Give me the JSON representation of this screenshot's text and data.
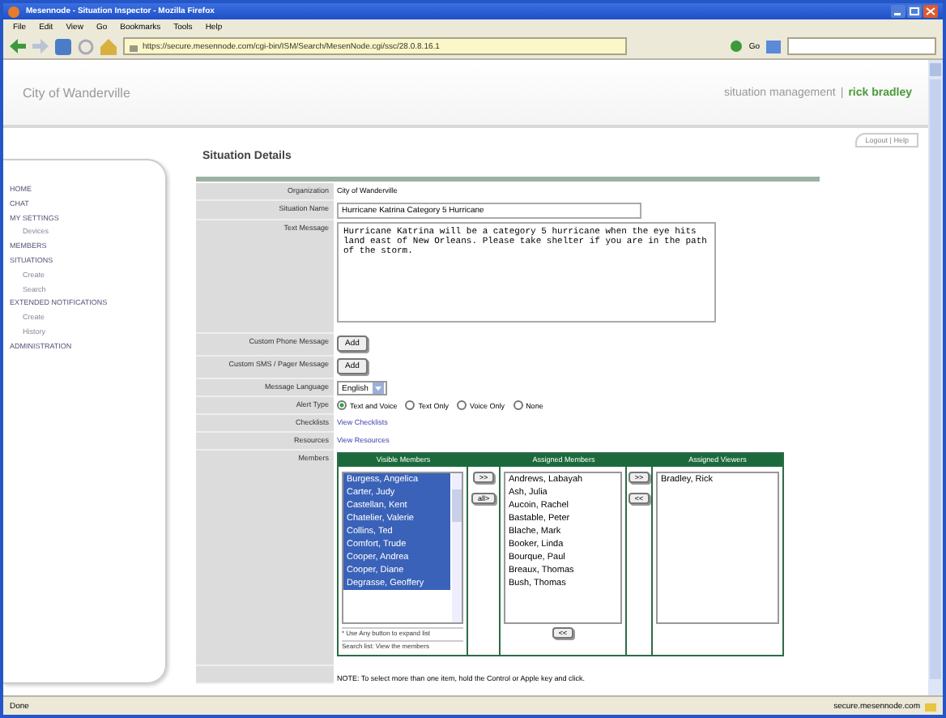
{
  "window": {
    "title": "Mesennode - Situation Inspector - Mozilla Firefox"
  },
  "menu": [
    "File",
    "Edit",
    "View",
    "Go",
    "Bookmarks",
    "Tools",
    "Help"
  ],
  "address": {
    "url": "https://secure.mesennode.com/cgi-bin/ISM/Search/MesenNode.cgi/ssc/28.0.8.16.1",
    "go": "Go"
  },
  "header": {
    "org": "City of Wanderville",
    "section": "situation management",
    "separator": "|",
    "user": "rick bradley",
    "links": "Logout | Help"
  },
  "sidebar": {
    "items": [
      {
        "label": "HOME"
      },
      {
        "label": "CHAT"
      },
      {
        "label": "MY SETTINGS",
        "children": [
          {
            "label": "Devices"
          }
        ]
      },
      {
        "label": "MEMBERS"
      },
      {
        "label": "SITUATIONS",
        "children": [
          {
            "label": "Create"
          },
          {
            "label": "Search"
          }
        ]
      },
      {
        "label": "EXTENDED NOTIFICATIONS",
        "children": [
          {
            "label": "Create"
          },
          {
            "label": "History"
          }
        ]
      },
      {
        "label": "ADMINISTRATION"
      }
    ]
  },
  "heading": "Situation Details",
  "form": {
    "organization": {
      "label": "Organization",
      "value": "City of Wanderville"
    },
    "name": {
      "label": "Situation Name",
      "value": "Hurricane Katrina Category 5 Hurricane"
    },
    "text": {
      "label": "Text Message",
      "value": "Hurricane Katrina will be a category 5 hurricane when the eye hits land east of New Orleans.  Please take shelter if you are in the path of the storm."
    },
    "phone": {
      "label": "Custom Phone Message",
      "button": "Add"
    },
    "sms": {
      "label": "Custom SMS / Pager Message",
      "button": "Add"
    },
    "language": {
      "label": "Message Language",
      "value": "English"
    },
    "alert": {
      "label": "Alert Type",
      "options": [
        {
          "label": "Text and Voice",
          "selected": true
        },
        {
          "label": "Text Only",
          "selected": false
        },
        {
          "label": "Voice Only",
          "selected": false
        },
        {
          "label": "None",
          "selected": false
        }
      ]
    },
    "checklists": {
      "label": "Checklists",
      "link": "View Checklists"
    },
    "resources": {
      "label": "Resources",
      "link": "View Resources"
    },
    "members": {
      "label": "Members",
      "visible": {
        "title": "Visible Members",
        "items": [
          {
            "label": "Burgess, Angelica",
            "selected": true
          },
          {
            "label": "Carter, Judy",
            "selected": true
          },
          {
            "label": "Castellan, Kent",
            "selected": true
          },
          {
            "label": "Chatelier, Valerie",
            "selected": true
          },
          {
            "label": "Collins, Ted",
            "selected": true
          },
          {
            "label": "Comfort, Trude",
            "selected": true
          },
          {
            "label": "Cooper, Andrea",
            "selected": true
          },
          {
            "label": "Cooper, Diane",
            "selected": true
          },
          {
            "label": "Degrasse, Geoffery",
            "selected": true
          }
        ],
        "hint": "* Use Any button to expand list",
        "hint2": "Search list: View the members"
      },
      "add_buttons": [
        ">>",
        "all>"
      ],
      "assigned": {
        "title": "Assigned Members",
        "items": [
          "Andrews, Labayah",
          "Ash, Julia",
          "Aucoin, Rachel",
          "Bastable, Peter",
          "Blache, Mark",
          "Booker, Linda",
          "Bourque, Paul",
          "Breaux, Thomas",
          "Bush, Thomas"
        ],
        "button": "<<"
      },
      "viewer_buttons": [
        ">>",
        "<<"
      ],
      "viewers": {
        "title": "Assigned Viewers",
        "items": [
          "Bradley, Rick"
        ]
      }
    },
    "note": "NOTE: To select more than one item, hold the Control or Apple key and click."
  },
  "status_bar": {
    "text": "Done",
    "site": "secure.mesennode.com"
  }
}
